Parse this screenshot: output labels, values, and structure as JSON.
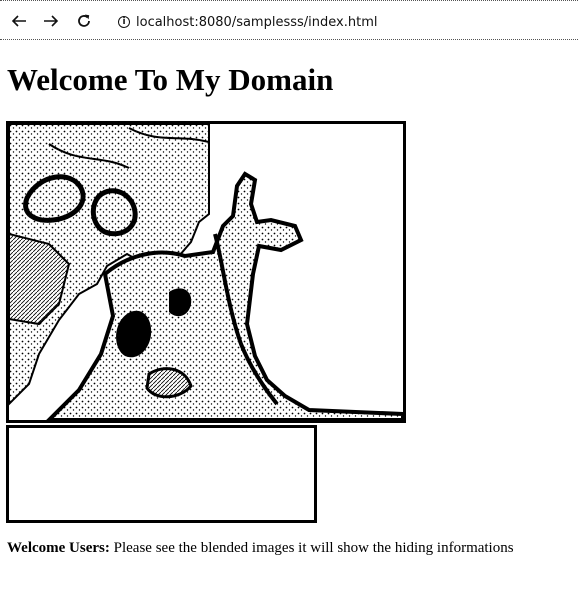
{
  "browser": {
    "url": "localhost:8080/samplesss/index.html",
    "back_icon": "arrow-left-icon",
    "forward_icon": "arrow-right-icon",
    "reload_icon": "reload-icon",
    "info_icon": "info-icon",
    "info_glyph": "i"
  },
  "page": {
    "heading": "Welcome To My Domain",
    "message_label": "Welcome Users:",
    "message_text": " Please see the blended images it will show the hiding informations"
  }
}
